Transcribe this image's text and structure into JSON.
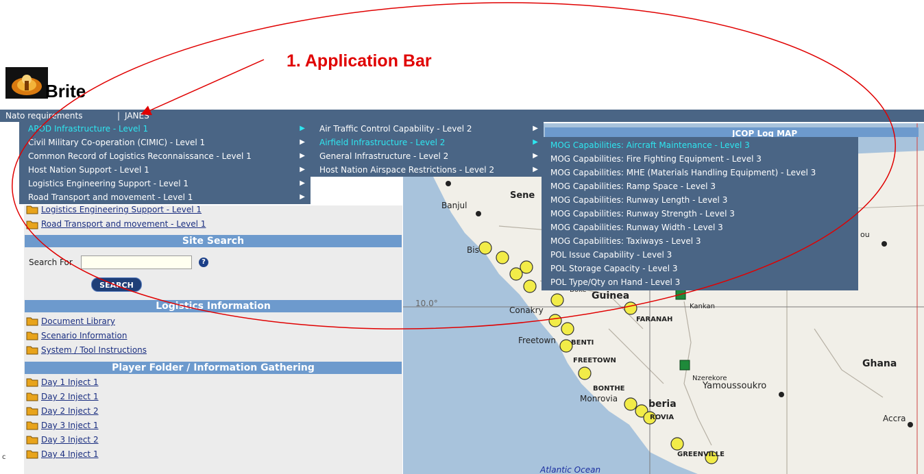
{
  "annotation": {
    "title": "1. Application Bar"
  },
  "brand": {
    "name": "Brite"
  },
  "navbar": {
    "item1": "Nato requirements",
    "separator": "|",
    "item2": "JANES"
  },
  "menu1": [
    {
      "label": "APOD Infrastructure - Level 1",
      "highlight": true
    },
    {
      "label": "Civil Military Co-operation (CIMIC) - Level 1",
      "highlight": false
    },
    {
      "label": "Common Record of Logistics Reconnaissance - Level 1",
      "highlight": false
    },
    {
      "label": "Host Nation Support - Level 1",
      "highlight": false
    },
    {
      "label": "Logistics Engineering Support - Level 1",
      "highlight": false
    },
    {
      "label": "Road Transport and movement - Level 1",
      "highlight": false
    }
  ],
  "menu2": [
    {
      "label": "Air Traffic Control Capability - Level 2",
      "highlight": false
    },
    {
      "label": "Airfield Infrastructure - Level 2",
      "highlight": true
    },
    {
      "label": "General Infrastructure - Level 2",
      "highlight": false
    },
    {
      "label": "Host Nation Airspace Restrictions - Level 2",
      "highlight": false
    }
  ],
  "menu3": [
    {
      "label": "MOG Capabilities: Aircraft Maintenance - Level 3",
      "highlight": true
    },
    {
      "label": "MOG Capabilities: Fire Fighting Equipment - Level 3",
      "highlight": false
    },
    {
      "label": "MOG Capabilities: MHE (Materials Handling Equipment) - Level 3",
      "highlight": false
    },
    {
      "label": "MOG Capabilities: Ramp Space - Level 3",
      "highlight": false
    },
    {
      "label": "MOG Capabilities: Runway Length - Level 3",
      "highlight": false
    },
    {
      "label": "MOG Capabilities: Runway Strength - Level 3",
      "highlight": false
    },
    {
      "label": "MOG Capabilities: Runway Width - Level 3",
      "highlight": false
    },
    {
      "label": "MOG Capabilities: Taxiways - Level 3",
      "highlight": false
    },
    {
      "label": "POL Issue Capability - Level 3",
      "highlight": false
    },
    {
      "label": "POL Storage Capacity - Level 3",
      "highlight": false
    },
    {
      "label": "POL Type/Qty on Hand - Level 3",
      "highlight": false
    }
  ],
  "left": {
    "top_links": [
      "Logistics Engineering Support - Level 1",
      "Road Transport and movement - Level 1"
    ],
    "site_search": {
      "heading": "Site Search",
      "label": "Search For",
      "value": "",
      "button": "SEARCH",
      "help": "?"
    },
    "logistics": {
      "heading": "Logistics Information",
      "links": [
        "Document Library",
        "Scenario Information",
        "System / Tool Instructions"
      ]
    },
    "player": {
      "heading": "Player Folder / Information Gathering",
      "links": [
        "Day 1 Inject 1",
        "Day 2 Inject 1",
        "Day 2 Inject 2",
        "Day 3 Inject 1",
        "Day 3 Inject 2",
        "Day 4 Inject 1"
      ]
    }
  },
  "map": {
    "header": "JCOP Log MAP",
    "labels": {
      "banjul": "Banjul",
      "senegal": "Sene",
      "bissau": "Bis",
      "boke": "Boke",
      "guinea": "Guinea",
      "conakry": "Conakry",
      "kankan": "Kankan",
      "faranah": "FARANAH",
      "freetown": "Freetown",
      "benti": "BENTI",
      "freetown2": "FREETOWN",
      "bonthe": "BONTHE",
      "monrovia": "Monrovia",
      "liberia": "beria",
      "monrovia2": "ROVIA",
      "nzerekore": "Nzerekore",
      "yamoussoukro": "Yamoussoukro",
      "ghana": "Ghana",
      "accra": "Accra",
      "greenville": "GREENVILLE",
      "atlantic": "Atlantic Ocean",
      "ou": "ou",
      "lat": "10.0°"
    }
  },
  "stray": "c"
}
